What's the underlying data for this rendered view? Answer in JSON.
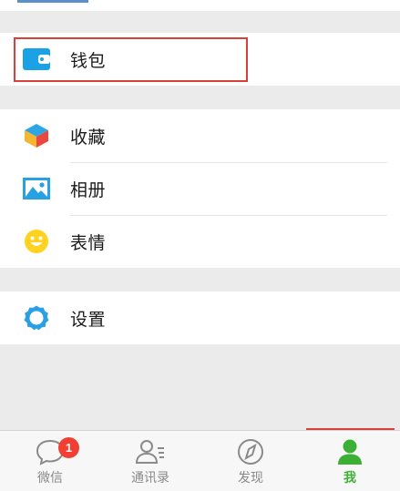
{
  "wallet": {
    "label": "钱包",
    "icon": "wallet-icon"
  },
  "menu_group_2": [
    {
      "label": "收藏",
      "icon": "favorites-cube-icon"
    },
    {
      "label": "相册",
      "icon": "album-picture-icon"
    },
    {
      "label": "表情",
      "icon": "smiley-face-icon"
    }
  ],
  "settings": {
    "label": "设置",
    "icon": "gear-icon"
  },
  "tabbar": {
    "chats": {
      "label": "微信",
      "badge": "1",
      "icon": "chat-bubble-icon"
    },
    "contacts": {
      "label": "通讯录",
      "icon": "contacts-icon"
    },
    "discover": {
      "label": "发现",
      "icon": "compass-icon"
    },
    "me": {
      "label": "我",
      "icon": "person-icon",
      "active": true
    }
  },
  "colors": {
    "accent_green": "#3cb034",
    "highlight_red": "#d9403a",
    "badge_red": "#f23f33",
    "wallet_blue": "#1aa1e6",
    "gear_blue": "#2b9fe5",
    "smiley_yellow": "#ffd21f"
  }
}
